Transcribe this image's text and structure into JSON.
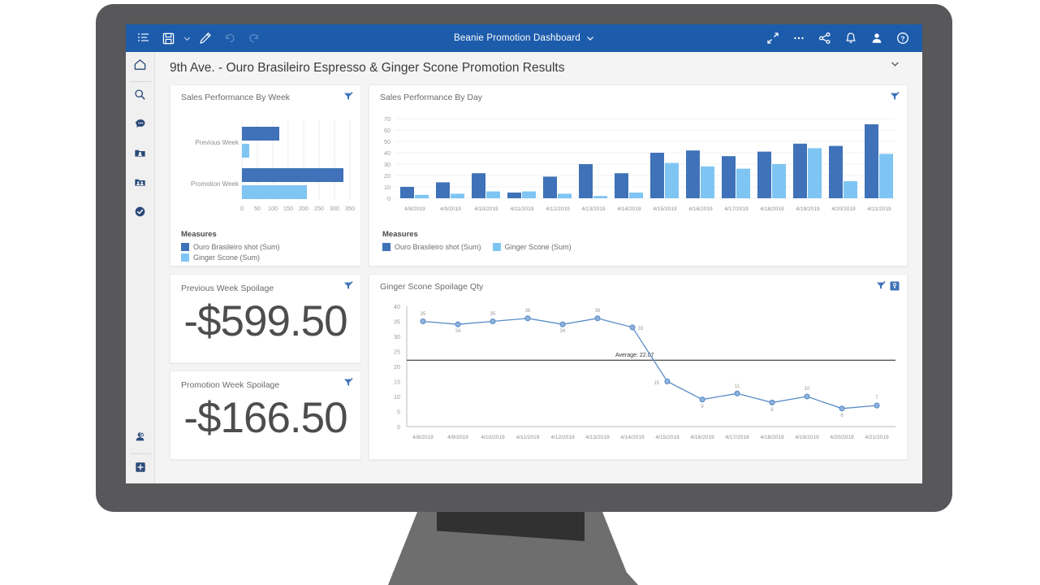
{
  "toolbar": {
    "title": "Beanie Promotion Dashboard",
    "left_icons": [
      {
        "name": "menu-list-icon",
        "label": "Menu"
      },
      {
        "name": "save-icon",
        "label": "Save"
      },
      {
        "name": "chevron-down-icon",
        "label": "Save options"
      },
      {
        "name": "edit-pencil-icon",
        "label": "Edit"
      },
      {
        "name": "undo-icon",
        "label": "Undo"
      },
      {
        "name": "redo-icon",
        "label": "Redo"
      }
    ],
    "right_icons": [
      {
        "name": "expand-icon",
        "label": "Full screen"
      },
      {
        "name": "more-ellipsis-icon",
        "label": "More"
      },
      {
        "name": "share-icon",
        "label": "Share"
      },
      {
        "name": "bell-icon",
        "label": "Notifications"
      },
      {
        "name": "user-icon",
        "label": "Account"
      },
      {
        "name": "help-icon",
        "label": "Help"
      }
    ],
    "title_caret": "chevron-down-icon"
  },
  "sidebar": {
    "items": [
      {
        "name": "sidebar-item-home",
        "icon": "home-icon",
        "label": "Home"
      },
      {
        "name": "sidebar-item-search",
        "icon": "search-icon",
        "label": "Search"
      },
      {
        "name": "sidebar-item-conversations",
        "icon": "chat-bubble-icon",
        "label": "Conversations"
      },
      {
        "name": "sidebar-item-my-content",
        "icon": "personal-folder-icon",
        "label": "My Content"
      },
      {
        "name": "sidebar-item-shared",
        "icon": "shared-folder-icon",
        "label": "Shared"
      },
      {
        "name": "sidebar-item-approved",
        "icon": "check-circle-icon",
        "label": "Approved"
      }
    ],
    "bottom_items": [
      {
        "name": "sidebar-item-profile-verified",
        "icon": "user-check-icon",
        "label": "Profile"
      },
      {
        "name": "sidebar-item-add",
        "icon": "plus-icon",
        "label": "Add"
      }
    ]
  },
  "page": {
    "title": "9th Ave. - Ouro Brasileiro Espresso & Ginger Scone Promotion Results",
    "collapse_icon": "chevron-down-icon"
  },
  "colors": {
    "toolbar_blue": "#1d5cab",
    "series_dark": "#3f72b8",
    "series_light": "#7ec5f4",
    "filter_blue": "#3f72b8",
    "line_blue": "#5b8cc8",
    "kpi_text": "#4d4d4d",
    "monitor_bezel": "#58585a"
  },
  "cards": {
    "sales_by_week": {
      "title": "Sales Performance By Week",
      "filter_icon": "filter-icon",
      "legend_title": "Measures",
      "legend": [
        {
          "label": "Ouro Brasileiro shot (Sum)",
          "color": "#3f72b8"
        },
        {
          "label": "Ginger Scone (Sum)",
          "color": "#7ec5f4"
        }
      ]
    },
    "sales_by_day": {
      "title": "Sales Performance By Day",
      "filter_icon": "filter-icon",
      "legend_title": "Measures",
      "legend": [
        {
          "label": "Ouro Brasileiro shot (Sum)",
          "color": "#3f72b8"
        },
        {
          "label": "Ginger Scone (Sum)",
          "color": "#7ec5f4"
        }
      ]
    },
    "previous_week_spoilage": {
      "title": "Previous Week Spoilage",
      "value": "-$599.50",
      "filter_icon": "filter-icon"
    },
    "promotion_week_spoilage": {
      "title": "Promotion Week Spoilage",
      "value": "-$166.50",
      "filter_icon": "filter-icon"
    },
    "ginger_scone_spoilage_qty": {
      "title": "Ginger Scone Spoilage Qty",
      "filter_icon": "filter-icon",
      "badge_icon": "key-badge-icon"
    }
  },
  "chart_data": [
    {
      "type": "bar",
      "orientation": "horizontal",
      "title": "Sales Performance By Week",
      "categories": [
        "Previous Week",
        "Promotion Week"
      ],
      "series": [
        {
          "name": "Ouro Brasileiro shot (Sum)",
          "color": "#3f72b8",
          "values": [
            122,
            330
          ]
        },
        {
          "name": "Ginger Scone (Sum)",
          "color": "#7ec5f4",
          "values": [
            22,
            210
          ]
        }
      ],
      "xlabel": "",
      "ylabel": "",
      "xlim": [
        0,
        350
      ],
      "xticks": [
        0,
        50,
        100,
        150,
        200,
        250,
        300,
        350
      ],
      "grid": true,
      "legend_position": "bottom-left"
    },
    {
      "type": "bar",
      "orientation": "vertical",
      "title": "Sales Performance By Day",
      "categories": [
        "4/8/2019",
        "4/9/2019",
        "4/10/2019",
        "4/11/2019",
        "4/12/2019",
        "4/13/2019",
        "4/14/2019",
        "4/15/2019",
        "4/16/2019",
        "4/17/2019",
        "4/18/2019",
        "4/19/2019",
        "4/20/2019",
        "4/21/2019"
      ],
      "series": [
        {
          "name": "Ouro Brasileiro shot (Sum)",
          "color": "#3f72b8",
          "values": [
            10,
            14,
            22,
            5,
            19,
            30,
            22,
            40,
            42,
            37,
            41,
            48,
            46,
            65
          ]
        },
        {
          "name": "Ginger Scone (Sum)",
          "color": "#7ec5f4",
          "values": [
            3,
            4,
            6,
            6,
            4,
            2,
            5,
            31,
            28,
            26,
            30,
            44,
            15,
            39
          ]
        }
      ],
      "xlabel": "",
      "ylabel": "",
      "ylim": [
        0,
        70
      ],
      "yticks": [
        0,
        10,
        20,
        30,
        40,
        50,
        60,
        70
      ],
      "grid": true,
      "legend_position": "bottom-left"
    },
    {
      "type": "line",
      "title": "Ginger Scone Spoilage Qty",
      "x": [
        "4/8/2019",
        "4/9/2019",
        "4/10/2019",
        "4/11/2019",
        "4/12/2019",
        "4/13/2019",
        "4/14/2019",
        "4/15/2019",
        "4/16/2019",
        "4/17/2019",
        "4/18/2019",
        "4/19/2019",
        "4/20/2019",
        "4/21/2019"
      ],
      "series": [
        {
          "name": "Ginger Scone Spoilage Qty",
          "color": "#5b8cc8",
          "values": [
            35,
            34,
            35,
            36,
            34,
            36,
            33,
            15,
            9,
            11,
            8,
            10,
            6,
            7
          ]
        }
      ],
      "data_labels": [
        "35",
        "34",
        "35",
        "36",
        "34",
        "36",
        "33",
        "15",
        "9",
        "11",
        "8",
        "10",
        "6",
        "7"
      ],
      "annotations": [
        {
          "type": "average-line",
          "label": "Average: 22.07",
          "value": 22.07
        }
      ],
      "ylim": [
        0,
        40
      ],
      "yticks": [
        0,
        5,
        10,
        15,
        20,
        25,
        30,
        35,
        40
      ],
      "grid": false,
      "legend_position": "none"
    }
  ]
}
